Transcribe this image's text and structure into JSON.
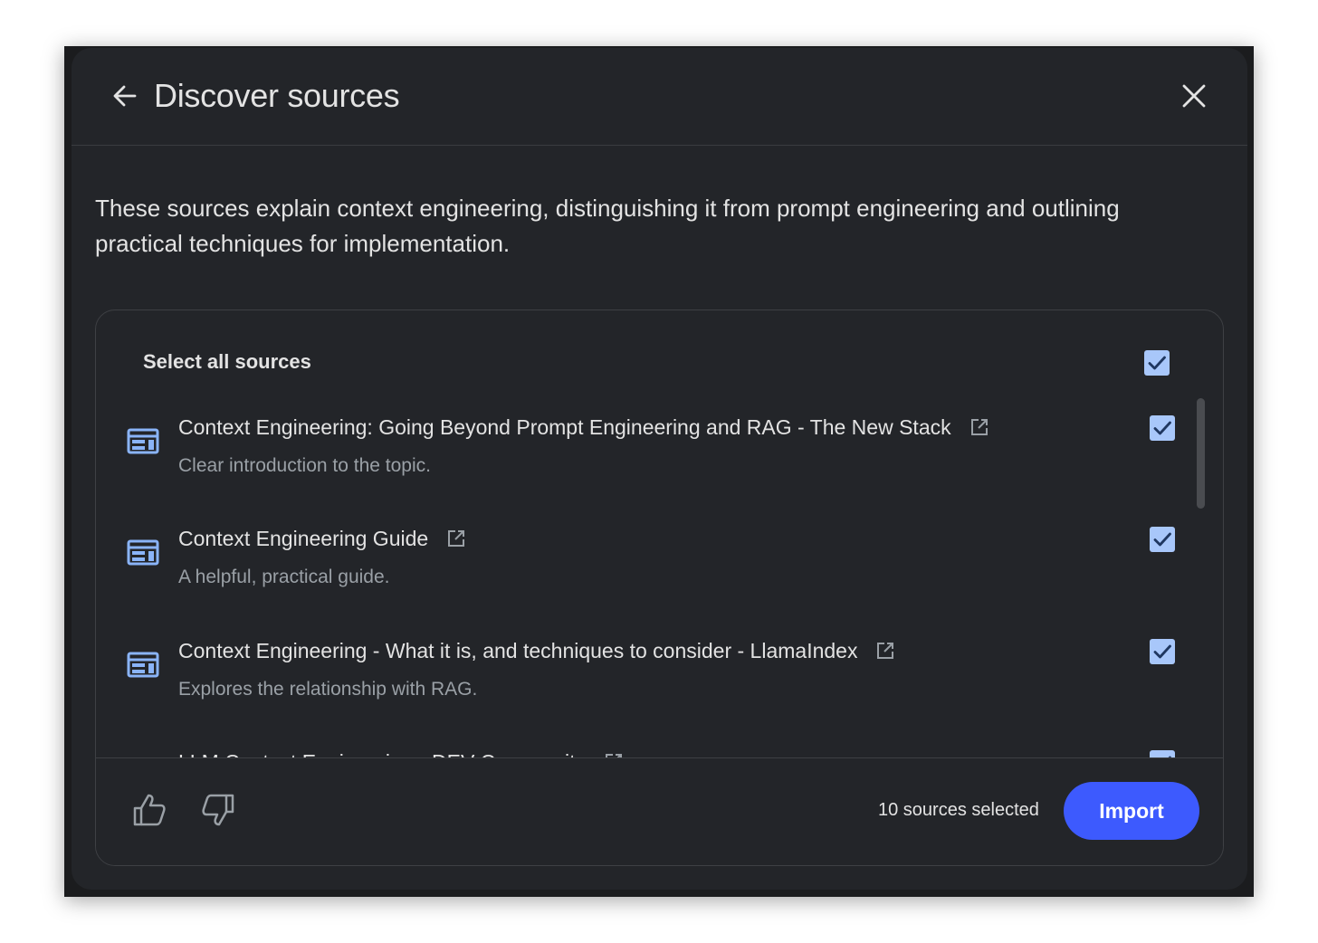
{
  "dialog": {
    "title": "Discover sources",
    "description": "These sources explain context engineering, distinguishing it from prompt engineering and outlining practical techniques for implementation."
  },
  "select_all": {
    "label": "Select all sources",
    "checked": true
  },
  "sources": [
    {
      "title": "Context Engineering: Going Beyond Prompt Engineering and RAG - The New Stack",
      "subtitle": "Clear introduction to the topic.",
      "icon": "web-page-icon",
      "checked": true
    },
    {
      "title": "Context Engineering Guide",
      "subtitle": "A helpful, practical guide.",
      "icon": "web-page-icon",
      "checked": true
    },
    {
      "title": "Context Engineering - What it is, and techniques to consider - LlamaIndex",
      "subtitle": "Explores the relationship with RAG.",
      "icon": "web-page-icon",
      "checked": true
    },
    {
      "title": "LLM Context Engineering - DEV Community",
      "subtitle": "",
      "icon": "web-page-icon",
      "checked": true
    }
  ],
  "footer": {
    "selected_count": "10 sources selected",
    "import_label": "Import"
  },
  "colors": {
    "background": "#232529",
    "checkbox": "#a8c7fa",
    "icon_blue": "#8ab4f8",
    "import_button": "#3d5afe",
    "text_primary": "#e3e3e3",
    "text_secondary": "#9aa0a6"
  }
}
